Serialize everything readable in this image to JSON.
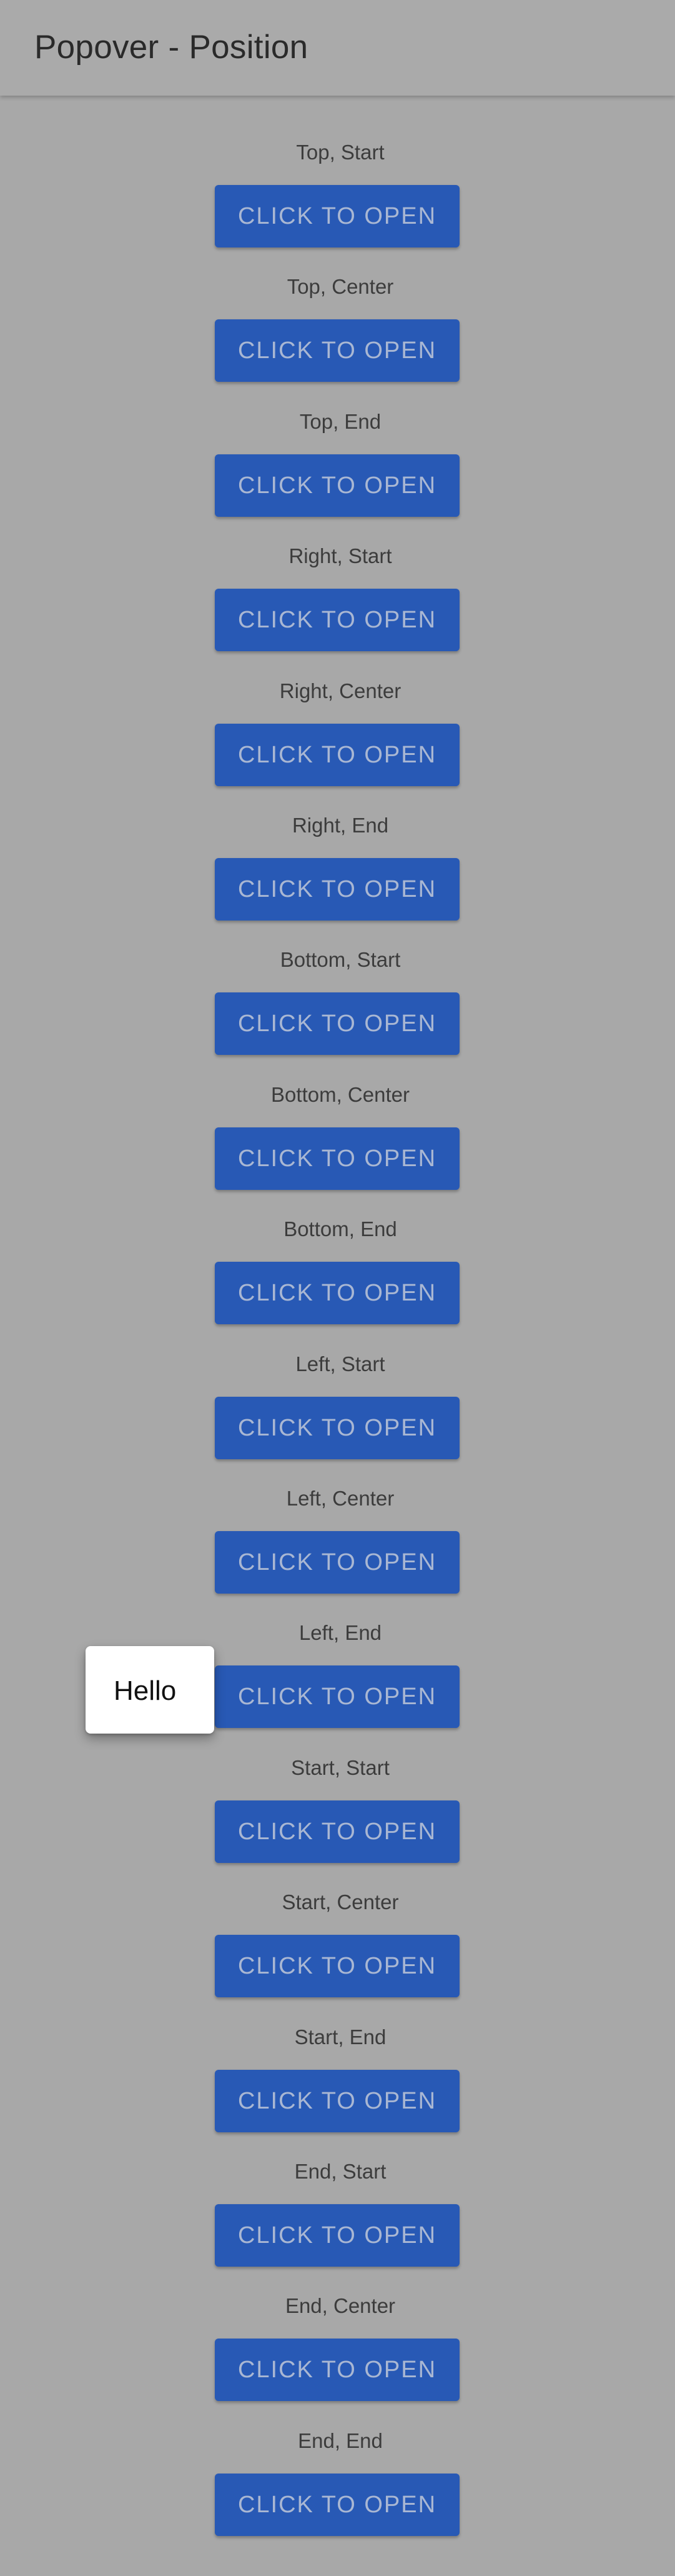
{
  "app_bar": {
    "title": "Popover - Position"
  },
  "sections": [
    {
      "label": "Top, Start",
      "button": "CLICK TO OPEN"
    },
    {
      "label": "Top, Center",
      "button": "CLICK TO OPEN"
    },
    {
      "label": "Top, End",
      "button": "CLICK TO OPEN"
    },
    {
      "label": "Right, Start",
      "button": "CLICK TO OPEN"
    },
    {
      "label": "Right, Center",
      "button": "CLICK TO OPEN"
    },
    {
      "label": "Right, End",
      "button": "CLICK TO OPEN"
    },
    {
      "label": "Bottom, Start",
      "button": "CLICK TO OPEN"
    },
    {
      "label": "Bottom, Center",
      "button": "CLICK TO OPEN"
    },
    {
      "label": "Bottom, End",
      "button": "CLICK TO OPEN"
    },
    {
      "label": "Left, Start",
      "button": "CLICK TO OPEN"
    },
    {
      "label": "Left, Center",
      "button": "CLICK TO OPEN"
    },
    {
      "label": "Left, End",
      "button": "CLICK TO OPEN"
    },
    {
      "label": "Start, Start",
      "button": "CLICK TO OPEN"
    },
    {
      "label": "Start, Center",
      "button": "CLICK TO OPEN"
    },
    {
      "label": "Start, End",
      "button": "CLICK TO OPEN"
    },
    {
      "label": "End, Start",
      "button": "CLICK TO OPEN"
    },
    {
      "label": "End, Center",
      "button": "CLICK TO OPEN"
    },
    {
      "label": "End, End",
      "button": "CLICK TO OPEN"
    }
  ],
  "popover": {
    "text": "Hello"
  },
  "colors": {
    "background": "#a8a8a8",
    "button": "#2859b5",
    "button_text": "#a9b7d3",
    "popover": "#ffffff"
  }
}
